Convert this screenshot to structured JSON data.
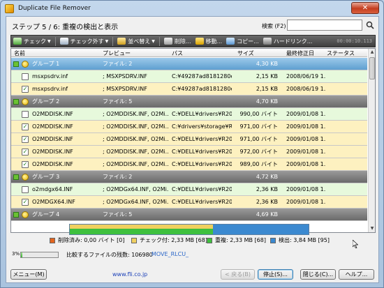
{
  "window": {
    "title": "Duplicate File Remover",
    "close": "✕"
  },
  "step_title": "ステップ 5 / 6: 重複の検出と表示",
  "search": {
    "label": "検索 (F2)",
    "value": ""
  },
  "toolbar": {
    "check": "チェック",
    "uncheck": "チェック外す",
    "sort": "並べ替え",
    "delete": "削除...",
    "move": "移動...",
    "copy": "コピー...",
    "hardlink": "ハードリンク...",
    "timer": "00:00:10.113"
  },
  "columns": {
    "name": "名前",
    "preview": "プレビュー",
    "path": "パス",
    "size": "サイズ",
    "modified": "最終修正日",
    "status": "ステータス"
  },
  "rows": [
    {
      "type": "group",
      "name": "グループ 1",
      "preview": "ファイル: 2",
      "size": "4,30 KB",
      "selected": true
    },
    {
      "type": "file",
      "checked": false,
      "name": "msxpsdrv.inf",
      "preview": "; MSXPSDRV.INF",
      "path": "C:¥49287ad8181280e6...",
      "size": "2,15 KB",
      "modified": "2008/06/19 1..."
    },
    {
      "type": "file",
      "checked": true,
      "name": "msxpsdrv.inf",
      "preview": "; MSXPSDRV.INF",
      "path": "C:¥49287ad8181280e6...",
      "size": "2,15 KB",
      "modified": "2008/06/19 1..."
    },
    {
      "type": "group",
      "name": "グループ 2",
      "preview": "ファイル: 5",
      "size": "4,70 KB",
      "selected": false
    },
    {
      "type": "file",
      "checked": false,
      "name": "O2MDDISK.INF",
      "preview": "; O2MDDISK.INF, O2Mi...",
      "path": "C:¥DELL¥drivers¥R208...",
      "size": "990,00 バイト",
      "modified": "2009/01/08 1..."
    },
    {
      "type": "file",
      "checked": true,
      "name": "O2MDDISK.INF",
      "preview": "; O2MDDISK.INF, O2Mi...",
      "path": "C:¥drivers¥storage¥R2...",
      "size": "971,00 バイト",
      "modified": "2009/01/08 1..."
    },
    {
      "type": "file",
      "checked": true,
      "name": "O2MDDISK.INF",
      "preview": "; O2MDDISK.INF, O2Mi...",
      "path": "C:¥DELL¥drivers¥R208...",
      "size": "971,00 バイト",
      "modified": "2009/01/08 1..."
    },
    {
      "type": "file",
      "checked": true,
      "name": "O2MDDISK.INF",
      "preview": "; O2MDDISK.INF, O2Mi...",
      "path": "C:¥DELL¥drivers¥R208...",
      "size": "972,00 バイト",
      "modified": "2009/01/08 1..."
    },
    {
      "type": "file",
      "checked": true,
      "name": "O2MDDISK.INF",
      "preview": "; O2MDDISK.INF, O2Mi...",
      "path": "C:¥DELL¥drivers¥R208...",
      "size": "989,00 バイト",
      "modified": "2009/01/08 1..."
    },
    {
      "type": "group",
      "name": "グループ 3",
      "preview": "ファイル: 2",
      "size": "4,72 KB",
      "selected": false
    },
    {
      "type": "file",
      "checked": false,
      "name": "o2mdgx64.INF",
      "preview": "; O2MDGx64.INF, O2Mi...",
      "path": "C:¥DELL¥drivers¥R208...",
      "size": "2,36 KB",
      "modified": "2009/01/08 1..."
    },
    {
      "type": "file",
      "checked": true,
      "name": "O2MDGX64.INF",
      "preview": "; O2MDGx64.INF, O2Mi...",
      "path": "C:¥DELL¥drivers¥R208...",
      "size": "2,36 KB",
      "modified": "2009/01/08 1..."
    },
    {
      "type": "group",
      "name": "グループ 4",
      "preview": "ファイル: 5",
      "size": "4,69 KB",
      "selected": false
    }
  ],
  "summary": {
    "deleted": "削除済み: 0,00 バイト [0]",
    "checked": "チェック付: 2,33 MB [68]",
    "duplicates": "重複: 2,33 MB [68]",
    "detected": "検出: 3,84 MB [95]",
    "bar": {
      "checked_fraction": 0.6,
      "duplicate_fraction": 0.6
    }
  },
  "colors": {
    "deleted": "#e3641e",
    "checked": "#f0d060",
    "duplicates": "#3ec03e",
    "detected": "#3b89d0"
  },
  "progress": {
    "percent_label": "3%",
    "fraction": 0.03,
    "label": "比較するファイルの残数: 106980",
    "current_file": "MOVE_RLCU_"
  },
  "footer": {
    "menu": "メニュー(M)",
    "site": "www.fli.co.jp",
    "back": "< 戻る(B)",
    "stop": "停止(S)...",
    "close": "閉じる(C)...",
    "help": "ヘルプ..."
  }
}
